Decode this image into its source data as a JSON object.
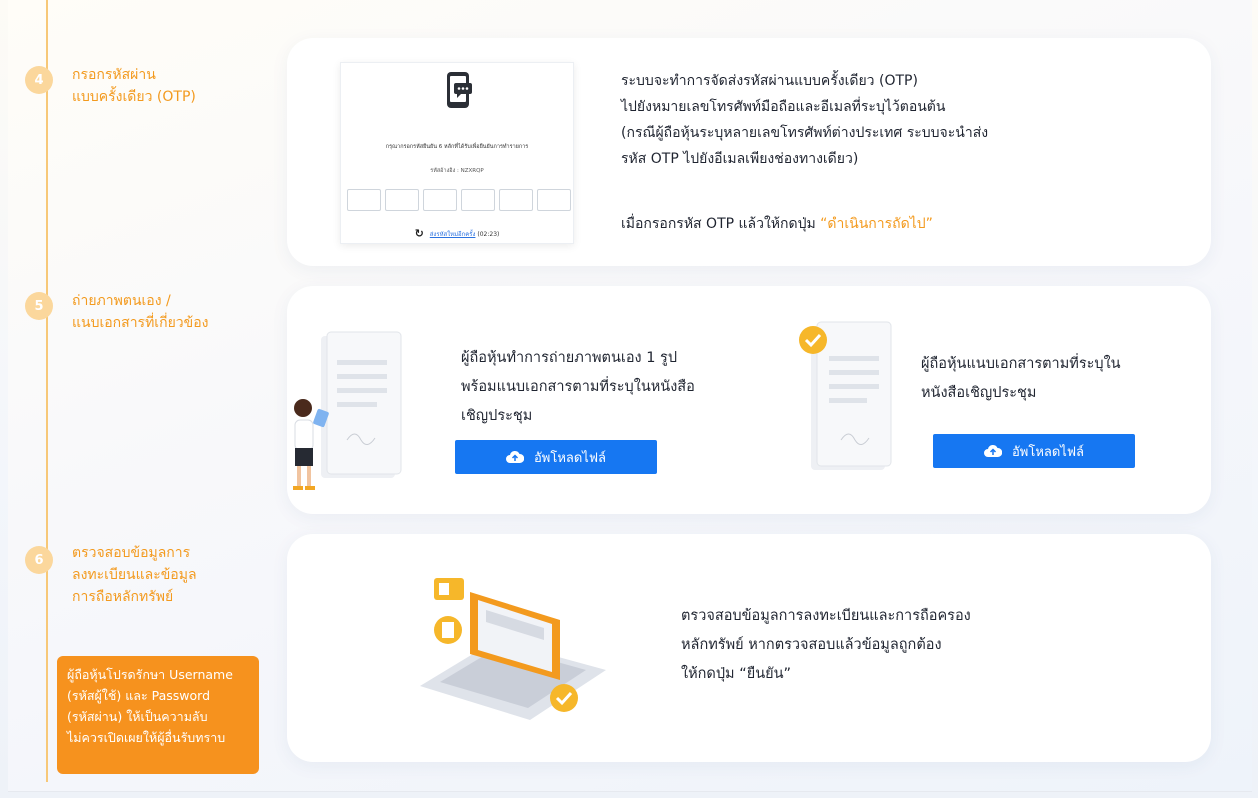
{
  "steps": [
    {
      "number": "4",
      "title": "กรอกรหัสผ่าน\nแบบครั้งเดียว (OTP)"
    },
    {
      "number": "5",
      "title": "ถ่ายภาพตนเอง /\nแนบเอกสารที่เกี่ยวข้อง"
    },
    {
      "number": "6",
      "title": "ตรวจสอบข้อมูลการ\nลงทะเบียนและข้อมูล\nการถือหลักทรัพย์"
    }
  ],
  "warning": "ผู้ถือหุ้นโปรดรักษา Username\n(รหัสผู้ใช้) และ Password\n(รหัสผ่าน) ให้เป็นความลับ\nไม่ควรเปิดเผยให้ผู้อื่นรับทราบ",
  "otp_card": {
    "instruction": "กรุณากรอกรหัสยืนยัน 6 หลักที่ได้รับเพื่อยืนยันการทำรายการ",
    "reference": "รหัสอ้างอิง : NZXRQP",
    "resend_label": "ส่งรหัสใหม่อีกครั้ง",
    "timer": "(02:23)",
    "description": "ระบบจะทำการจัดส่งรหัสผ่านแบบครั้งเดียว (OTP)\nไปยังหมายเลขโทรศัพท์มือถือและอีเมลที่ระบุไว้ตอนต้น\n(กรณีผู้ถือหุ้นระบุหลายเลขโทรศัพท์ต่างประเทศ ระบบจะนำส่ง\nรหัส OTP ไปยังอีเมลเพียงช่องทางเดียว)",
    "next_prefix": "เมื่อกรอกรหัส OTP แล้วให้กดปุ่ม ",
    "next_highlight": "“ดำเนินการถัดไป”"
  },
  "upload_card": {
    "selfie_text": "ผู้ถือหุ้นทำการถ่ายภาพตนเอง 1 รูป\nพร้อมแนบเอกสารตามที่ระบุในหนังสือ\nเชิญประชุม",
    "docs_text": "ผู้ถือหุ้นแนบเอกสารตามที่ระบุใน\nหนังสือเชิญประชุม",
    "upload_label": "อัพโหลดไฟล์"
  },
  "verify_card": {
    "text": "ตรวจสอบข้อมูลการลงทะเบียนและการถือครอง\nหลักทรัพย์ หากตรวจสอบแล้วข้อมูลถูกต้อง\nให้กดปุ่ม “ยืนยัน”"
  },
  "colors": {
    "accent": "#f39a1e",
    "button": "#1677f2",
    "warning_bg": "#f6921e"
  }
}
